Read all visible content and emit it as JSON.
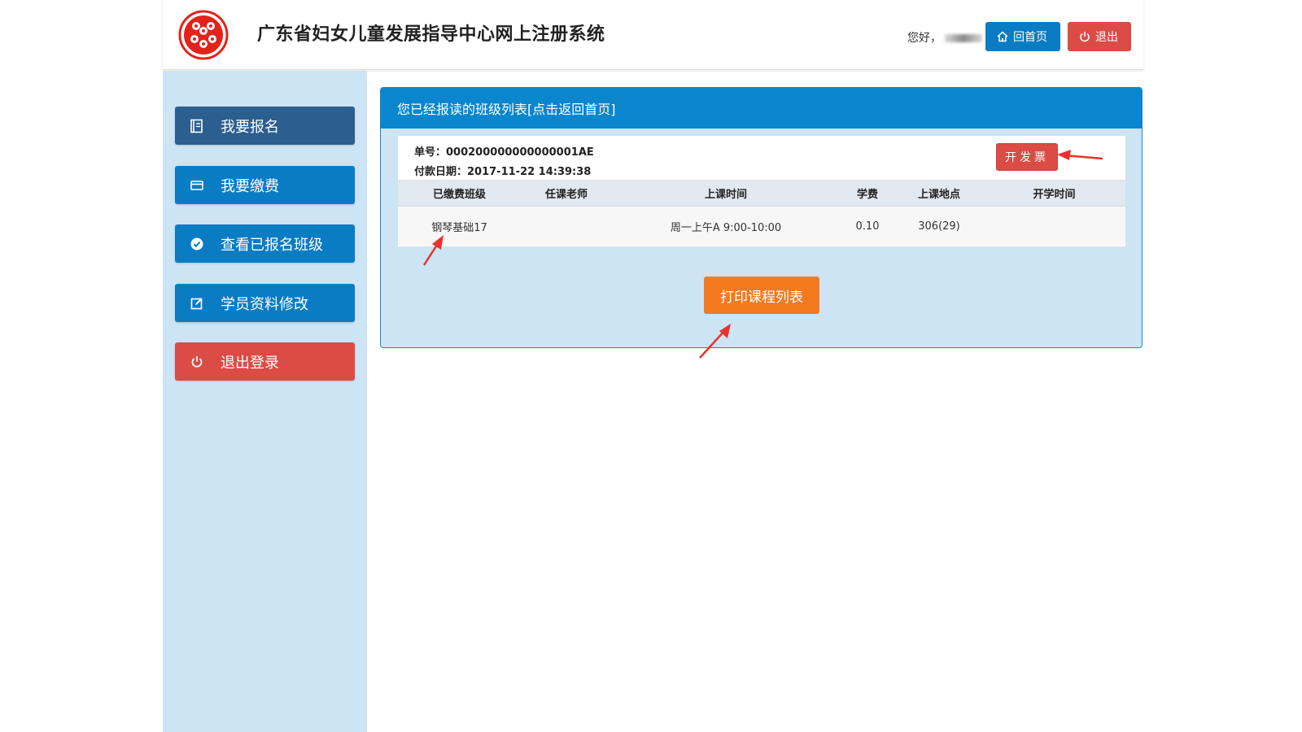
{
  "header": {
    "site_title": "广东省妇女儿童发展指导中心网上注册系统",
    "greeting": "您好，",
    "home_button": "回首页",
    "exit_button": "退出"
  },
  "sidebar": {
    "items": [
      {
        "label": "我要报名",
        "icon": "register-icon"
      },
      {
        "label": "我要缴费",
        "icon": "card-icon"
      },
      {
        "label": "查看已报名班级",
        "icon": "check-circle-icon"
      },
      {
        "label": "学员资料修改",
        "icon": "edit-icon"
      },
      {
        "label": "退出登录",
        "icon": "power-icon"
      }
    ]
  },
  "panel": {
    "title": "您已经报读的班级列表[点击返回首页]",
    "order": {
      "number": "单号：000200000000000001AE",
      "pay_date": "付款日期：2017-11-22 14:39:38",
      "invoice_button": "开发票"
    },
    "table": {
      "headers": [
        "已缴费班级",
        "任课老师",
        "上课时间",
        "学费",
        "上课地点",
        "开学时间"
      ],
      "rows": [
        {
          "class": "钢琴基础17",
          "teacher": "",
          "time": "周一上午A 9:00-10:00",
          "fee": "0.10",
          "location": "306(29)",
          "start": ""
        }
      ]
    },
    "print_button": "打印课程列表"
  },
  "colors": {
    "primary_blue": "#0a7cc4",
    "dark_blue": "#2b5f8f",
    "danger_red": "#dc4b45",
    "orange": "#f47a20",
    "light_blue_bg": "#cce4f4",
    "annotation_red": "#e8322d"
  }
}
